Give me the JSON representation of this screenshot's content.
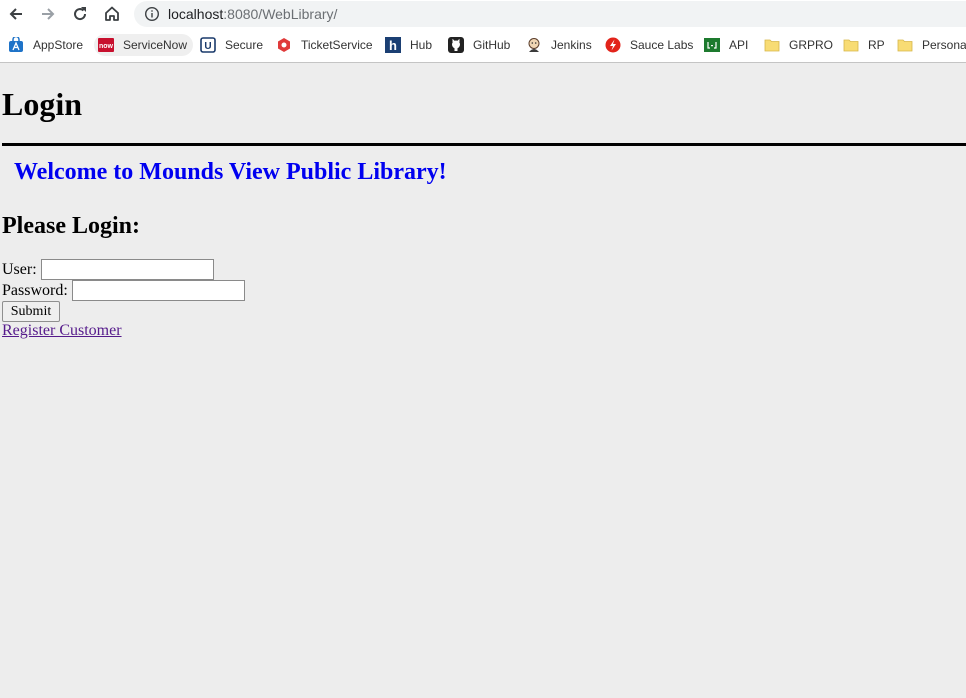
{
  "browser": {
    "url_host": "localhost",
    "url_rest": ":8080/WebLibrary/",
    "bookmarks": [
      {
        "label": "AppStore",
        "icon": "appstore-icon"
      },
      {
        "label": "ServiceNow",
        "icon": "servicenow-icon",
        "icon_text": "now"
      },
      {
        "label": "Secure",
        "icon": "secure-icon",
        "icon_text": "U"
      },
      {
        "label": "TicketService",
        "icon": "ticketservice-icon"
      },
      {
        "label": "Hub",
        "icon": "hub-icon",
        "icon_text": "h"
      },
      {
        "label": "GitHub",
        "icon": "github-icon"
      },
      {
        "label": "Jenkins",
        "icon": "jenkins-icon"
      },
      {
        "label": "Sauce Labs",
        "icon": "saucelabs-icon"
      },
      {
        "label": "API",
        "icon": "api-icon"
      },
      {
        "label": "GRPRO",
        "icon": "folder-icon"
      },
      {
        "label": "RP",
        "icon": "folder-icon"
      },
      {
        "label": "Personal",
        "icon": "folder-icon"
      }
    ]
  },
  "page": {
    "title": "Login",
    "welcome": "Welcome to Mounds View Public Library!",
    "subtitle": "Please Login:",
    "user_label": "User:",
    "user_value": "",
    "password_label": "Password:",
    "password_value": "",
    "submit_label": "Submit",
    "register_link": "Register Customer"
  },
  "colors": {
    "page_background": "#ededed",
    "welcome_text": "#0000f0",
    "visited_link": "#551a8b"
  }
}
